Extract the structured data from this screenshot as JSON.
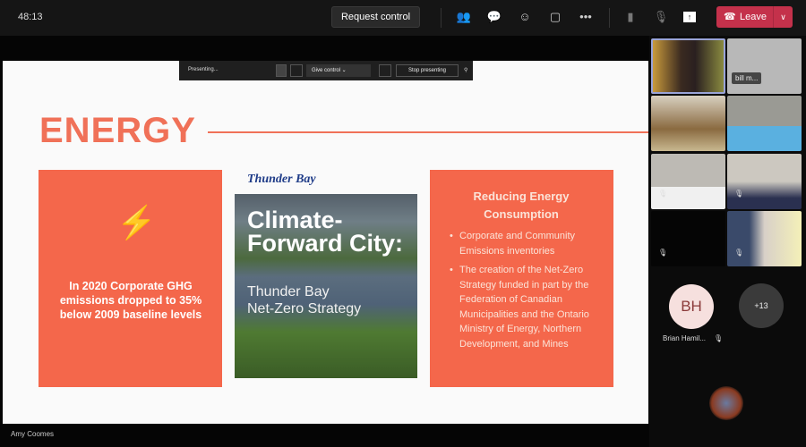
{
  "toolbar": {
    "timer": "48:13",
    "request_control": "Request control",
    "leave": "Leave",
    "icons": [
      "people-icon",
      "chat-icon",
      "reactions-icon",
      "share-tray-icon",
      "more-icon",
      "camera-off-icon",
      "mic-off-icon",
      "share-icon"
    ]
  },
  "presenter_bar": {
    "status": "Presenting...",
    "give_control": "Give control",
    "stop_presenting": "Stop presenting"
  },
  "slide": {
    "title": "ENERGY",
    "left_box": {
      "text": "In 2020 Corporate GHG emissions dropped to 35% below 2009 baseline levels"
    },
    "book": {
      "logo": "Thunder Bay",
      "title": "Climate-Forward City:",
      "subtitle_1": "Thunder Bay",
      "subtitle_2": "Net-Zero Strategy"
    },
    "right_box": {
      "title": "Reducing Energy Consumption",
      "bullets": [
        "Corporate and Community Emissions inventories",
        "The creation of the Net-Zero Strategy funded in part by the Federation of Canadian Municipalities and the Ontario Ministry of Energy, Northern Development, and Mines"
      ]
    }
  },
  "presenter_name": "Amy Coomes",
  "participants": {
    "tile_name": "bill m...",
    "avatar_initials": "BH",
    "avatar_name": "Brian Hamil...",
    "overflow": "+13"
  },
  "colors": {
    "accent": "#f4674b",
    "leave": "#c4314b"
  }
}
